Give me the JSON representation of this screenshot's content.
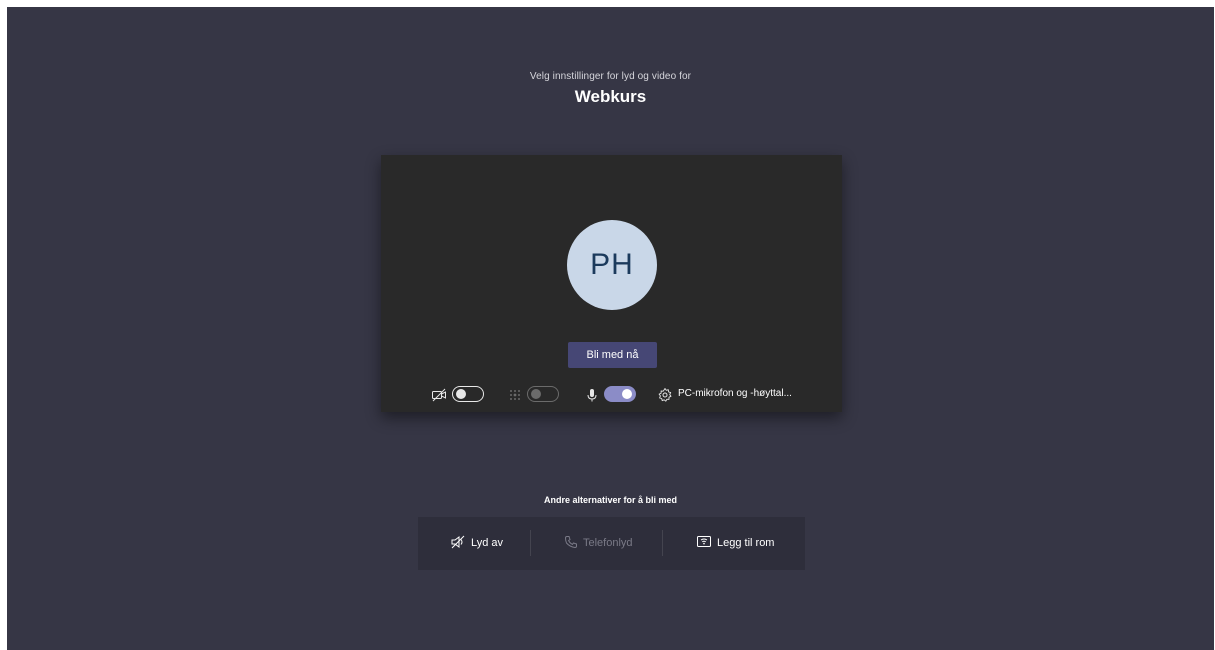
{
  "header": {
    "subtitle": "Velg innstillinger for lyd og video for",
    "meeting_title": "Webkurs"
  },
  "preview": {
    "avatar_initials": "PH",
    "join_button_label": "Bli med nå"
  },
  "controls": {
    "camera": {
      "icon": "camera-off-icon",
      "state": "off"
    },
    "background_blur": {
      "icon": "background-blur-icon",
      "state": "disabled"
    },
    "microphone": {
      "icon": "microphone-icon",
      "state": "on"
    },
    "device_settings": {
      "icon": "gear-icon",
      "label": "PC-mikrofon og -høyttal..."
    }
  },
  "alternatives": {
    "heading": "Andre alternativer for å bli med",
    "items": [
      {
        "icon": "speaker-off-icon",
        "label": "Lyd av",
        "enabled": true
      },
      {
        "icon": "phone-icon",
        "label": "Telefonlyd",
        "enabled": false
      },
      {
        "icon": "room-cast-icon",
        "label": "Legg til rom",
        "enabled": true
      }
    ]
  },
  "colors": {
    "background": "#363645",
    "preview_bg": "#292929",
    "accent": "#464775",
    "toggle_on": "#8b8cc7",
    "avatar_bg": "#c9d7e8",
    "avatar_text": "#1b3a5c"
  }
}
